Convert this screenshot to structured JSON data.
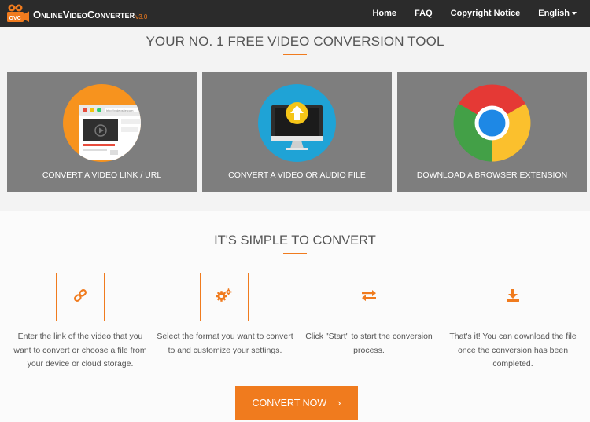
{
  "brand": {
    "name_first": "Online",
    "name_second": "Video",
    "name_third": "Converter",
    "version": "v3.0",
    "colors": {
      "accent": "#f07b1e",
      "navbar": "#2b2b2b",
      "card": "#7e7e7e"
    }
  },
  "nav": {
    "home": "Home",
    "faq": "FAQ",
    "copyright": "Copyright Notice",
    "language": "English"
  },
  "hero": {
    "title": "YOUR NO. 1 FREE VIDEO CONVERSION TOOL",
    "cards": [
      {
        "label": "CONVERT A VIDEO LINK / URL",
        "icon": "browser-video-icon"
      },
      {
        "label": "CONVERT A VIDEO OR AUDIO FILE",
        "icon": "monitor-upload-icon"
      },
      {
        "label": "DOWNLOAD A BROWSER EXTENSION",
        "icon": "chrome-icon"
      }
    ],
    "url_bar_text": "http://videosite.com"
  },
  "steps": {
    "title": "IT'S SIMPLE TO CONVERT",
    "items": [
      {
        "icon": "link-icon",
        "text": "Enter the link of the video that you want to convert or choose a file from your device or cloud storage."
      },
      {
        "icon": "gears-icon",
        "text": "Select the format you want to convert to and customize your settings."
      },
      {
        "icon": "exchange-icon",
        "text": "Click \"Start\" to start the conversion process."
      },
      {
        "icon": "download-icon",
        "text": "That's it! You can download the file once the conversion has been completed."
      }
    ]
  },
  "cta": {
    "label": "CONVERT NOW",
    "chevron": "›"
  }
}
